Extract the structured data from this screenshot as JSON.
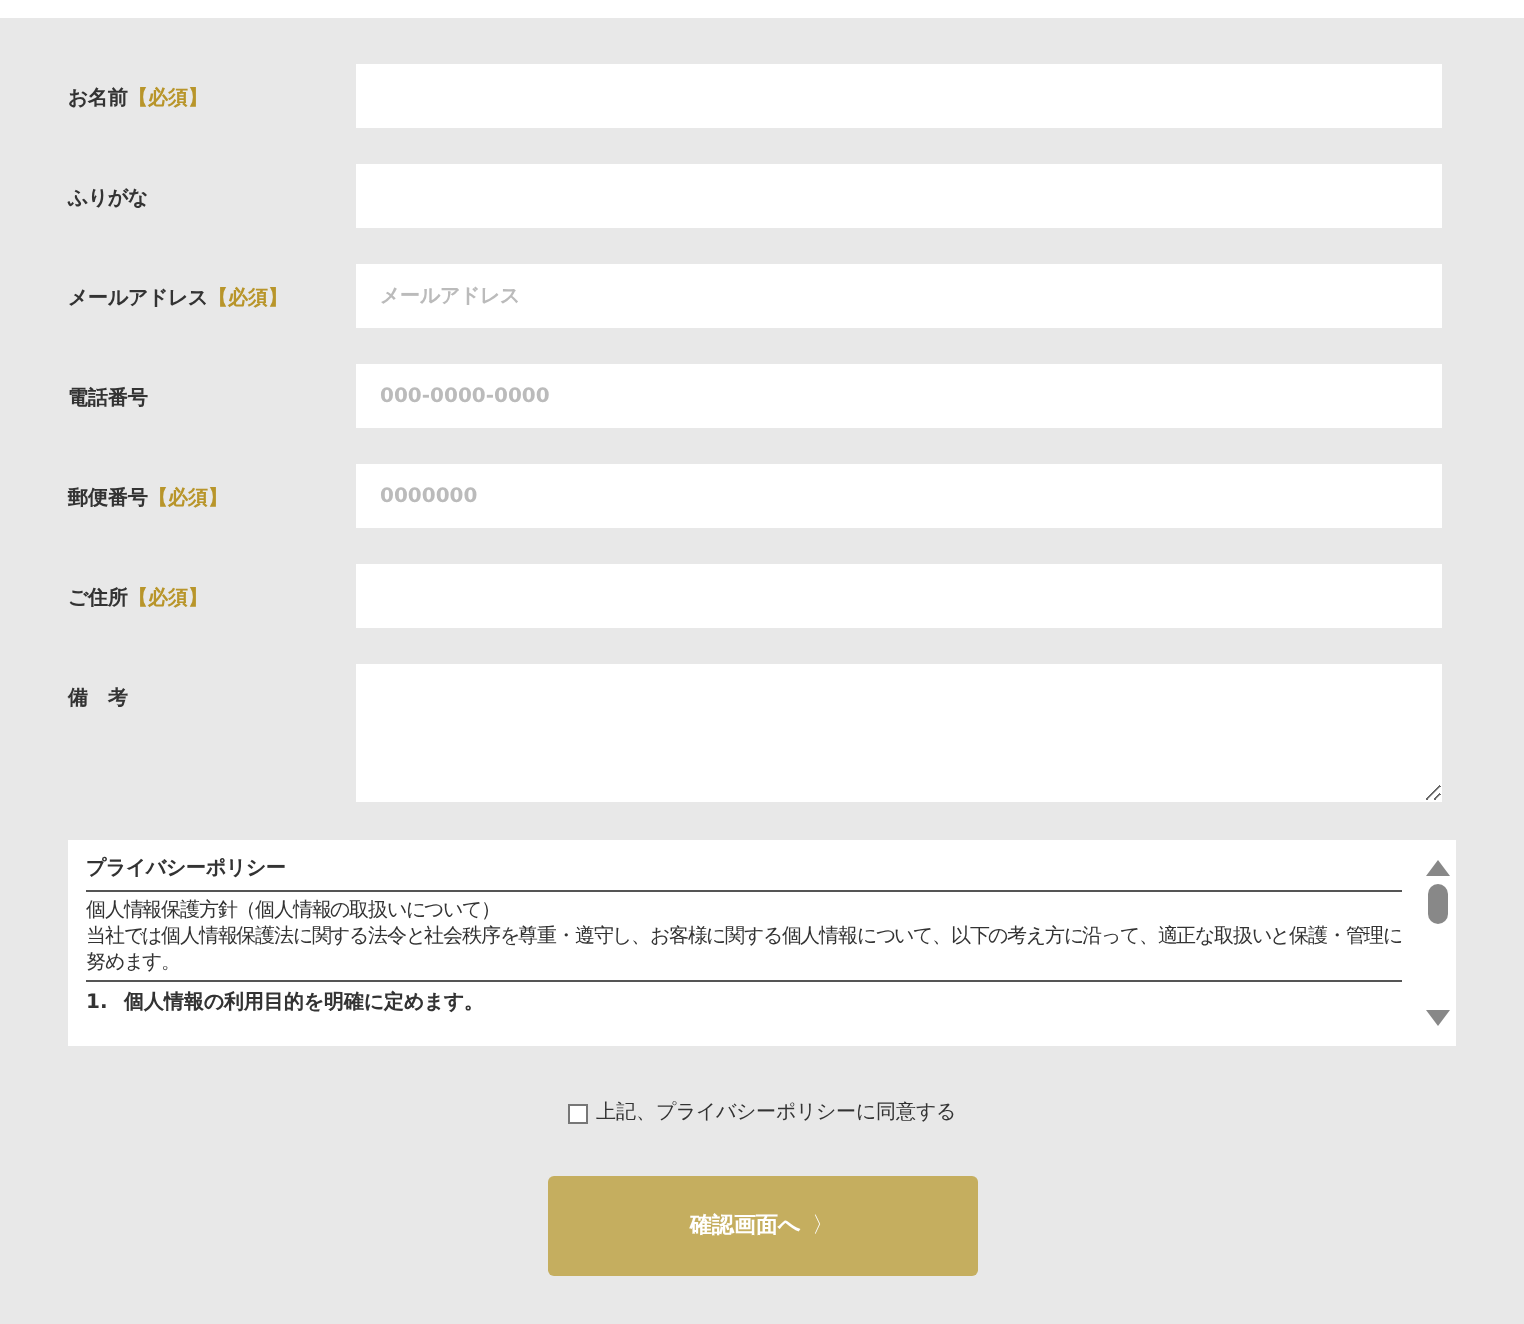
{
  "fields": [
    {
      "kind": "input",
      "label": "お名前",
      "required_mark": "【必須】"
    },
    {
      "kind": "input",
      "label": "ふりがな"
    },
    {
      "kind": "input",
      "label": "メールアドレス",
      "required_mark": "【必須】",
      "placeholder": "メールアドレス"
    },
    {
      "kind": "input",
      "label": "電話番号",
      "placeholder": "000-0000-0000"
    },
    {
      "kind": "input",
      "label": "郵便番号",
      "required_mark": "【必須】",
      "placeholder": "0000000"
    },
    {
      "kind": "input",
      "label": "ご住所",
      "required_mark": "【必須】"
    },
    {
      "kind": "textarea",
      "label": "備　考"
    }
  ],
  "privacy_policy": {
    "title": "プライバシーポリシー",
    "heading": "個人情報保護方針（個人情報の取扱いについて）",
    "body": "当社では個人情報保護法に関する法令と社会秩序を尊重・遵守し、お客様に関する個人情報について、以下の考え方に沿って、適正な取扱いと保護・管理に努めます。",
    "items": [
      {
        "number": "1.",
        "text": "個人情報の利用目的を明確に定めます。"
      }
    ]
  },
  "agreement": {
    "label": "上記、プライバシーポリシーに同意する",
    "checked": false
  },
  "submit_button": {
    "label": "確認画面へ",
    "arrow": "〉"
  }
}
